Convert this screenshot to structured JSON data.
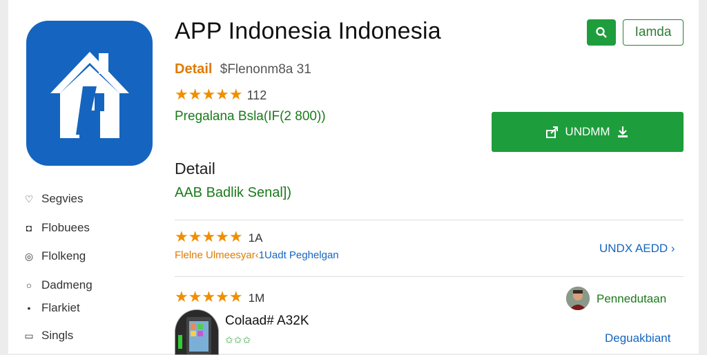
{
  "app": {
    "title": "APP Indonesia Indonesia",
    "detail_link": "Detail",
    "detail_sub": "$Flenonm8a 31",
    "rating_stars": "★★★★★",
    "rating_count": "112",
    "price": "Pregalana Bsla(IF(2 800))",
    "install_label": "UNDMM"
  },
  "header": {
    "lang_label": "Iamda",
    "brand_color": "#1e9d3c"
  },
  "section": {
    "heading": "Detail",
    "sub": "AAB Badlik Senal])"
  },
  "sidebar": {
    "items": [
      {
        "label": "Segvies",
        "icon": "heart-icon"
      },
      {
        "label": "Flobuees",
        "icon": "shield-icon"
      },
      {
        "label": "Flolkeng",
        "icon": "location-icon"
      },
      {
        "label": "Dadmeng",
        "icon": "circle-icon"
      },
      {
        "label": "Flarkiet",
        "icon": "dot-icon"
      },
      {
        "label": "Singls",
        "icon": "square-icon"
      }
    ]
  },
  "reviews": [
    {
      "stars": "★★★★★",
      "count": "1A",
      "meta_orange": "Flelne Ulmeesyar‹",
      "meta_blue": "1Uadt Peghelgan",
      "link": "UNDX AEDD ›"
    },
    {
      "stars": "★★★★★",
      "count": "1M",
      "user_name": "Pennedutaan",
      "device_name": "Colaad# A32K",
      "device_stars": "✩✩✩",
      "link": "Deguakbiant"
    }
  ]
}
